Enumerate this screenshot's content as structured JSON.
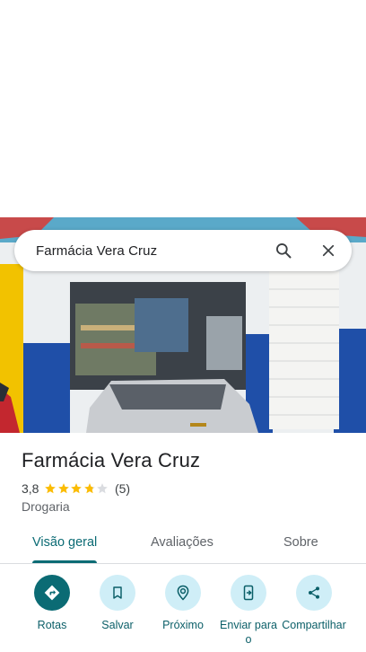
{
  "search": {
    "query": "Farmácia Vera Cruz"
  },
  "place": {
    "name": "Farmácia Vera Cruz",
    "rating": "3,8",
    "rating_value": 3.8,
    "review_count": "(5)",
    "category": "Drogaria"
  },
  "tabs": [
    {
      "label": "Visão geral",
      "active": true
    },
    {
      "label": "Avaliações",
      "active": false
    },
    {
      "label": "Sobre",
      "active": false
    }
  ],
  "actions": [
    {
      "label": "Rotas",
      "icon": "directions-icon"
    },
    {
      "label": "Salvar",
      "icon": "bookmark-icon"
    },
    {
      "label": "Próximo",
      "icon": "nearby-icon"
    },
    {
      "label": "Enviar para o",
      "icon": "send-to-phone-icon"
    },
    {
      "label": "Compartilhar",
      "icon": "share-icon"
    }
  ],
  "colors": {
    "accent": "#0b6b74",
    "action_bg": "#cfeef7",
    "star": "#fbbc04",
    "star_empty": "#dadce0"
  }
}
